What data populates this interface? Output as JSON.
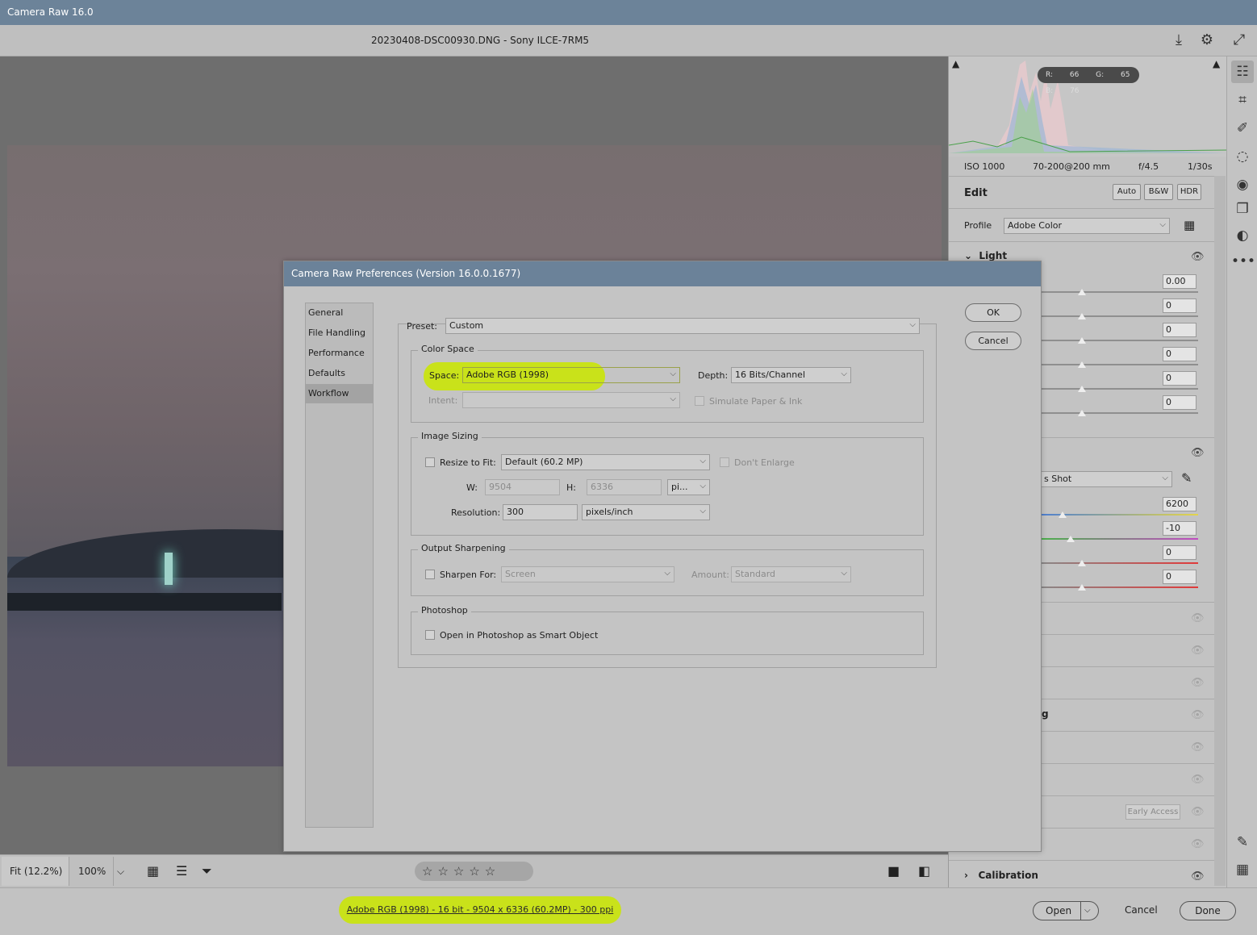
{
  "window": {
    "title": "Camera Raw 16.0"
  },
  "header": {
    "file_title": "20230408-DSC00930.DNG  -  Sony ILCE-7RM5"
  },
  "histogram": {
    "rgb_readout": "R: 66   G: 65   B: 76"
  },
  "exif": {
    "iso": "ISO 1000",
    "lens": "70-200@200 mm",
    "aperture": "f/4.5",
    "shutter": "1/30s"
  },
  "edit_panel": {
    "title": "Edit",
    "buttons": [
      "Auto",
      "B&W",
      "HDR"
    ],
    "profile_label": "Profile",
    "profile_value": "Adobe Color",
    "light_label": "Light",
    "light_values": [
      "0.00",
      "0",
      "0",
      "0",
      "0",
      "0"
    ],
    "wb_value": "s Shot",
    "color_values": [
      "6200",
      "-10",
      "0",
      "0"
    ],
    "partial_label": "g",
    "early_access": "Early Access",
    "calibration_label": "Calibration"
  },
  "preview_toolbar": {
    "fit_label": "Fit (12.2%)",
    "zoom_label": "100%",
    "stars": "☆☆☆☆☆"
  },
  "status_bar": {
    "workflow_link": "Adobe RGB (1998) - 16 bit - 9504 x 6336 (60.2MP) - 300 ppi",
    "open": "Open",
    "cancel": "Cancel",
    "done": "Done"
  },
  "dialog": {
    "title": "Camera Raw Preferences  (Version 16.0.0.1677)",
    "nav": [
      "General",
      "File Handling",
      "Performance",
      "Defaults",
      "Workflow"
    ],
    "selected_nav": "Workflow",
    "ok": "OK",
    "cancel": "Cancel",
    "preset_label": "Preset:",
    "preset_value": "Custom",
    "color_space": {
      "title": "Color Space",
      "space_label": "Space:",
      "space_value": "Adobe RGB (1998)",
      "depth_label": "Depth:",
      "depth_value": "16 Bits/Channel",
      "intent_label": "Intent:",
      "intent_value": "",
      "simulate_label": "Simulate Paper & Ink"
    },
    "image_sizing": {
      "title": "Image Sizing",
      "resize_label": "Resize to Fit:",
      "resize_value": "Default  (60.2 MP)",
      "dont_enlarge": "Don't Enlarge",
      "w_label": "W:",
      "w_value": "9504",
      "h_label": "H:",
      "h_value": "6336",
      "unit_value": "pi...",
      "resolution_label": "Resolution:",
      "resolution_value": "300",
      "resolution_unit": "pixels/inch"
    },
    "output_sharpening": {
      "title": "Output Sharpening",
      "sharpen_label": "Sharpen For:",
      "sharpen_value": "Screen",
      "amount_label": "Amount:",
      "amount_value": "Standard"
    },
    "photoshop": {
      "title": "Photoshop",
      "smart_object_label": "Open in Photoshop as Smart Object"
    }
  },
  "colors": {
    "accent_highlight": "#c9e21a",
    "titlebar": "#6c8399"
  }
}
